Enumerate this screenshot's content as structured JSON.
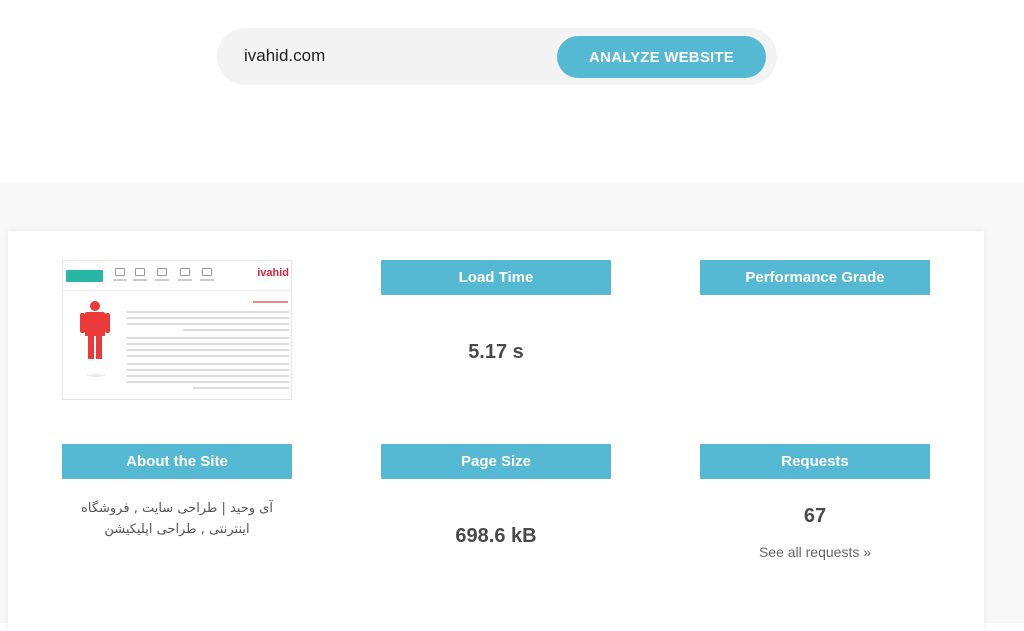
{
  "search": {
    "value": "ivahid.com",
    "button_label": "ANALYZE WEBSITE"
  },
  "results": {
    "load_time": {
      "label": "Load Time",
      "value": "5.17 s"
    },
    "performance_grade": {
      "label": "Performance Grade"
    },
    "about": {
      "label": "About the Site",
      "description": "آی وحید | طراحی سایت , فروشگاه اینترنتی , طراحی اپلیکیشن"
    },
    "page_size": {
      "label": "Page Size",
      "value": "698.6 kB"
    },
    "requests": {
      "label": "Requests",
      "value": "67",
      "link": "See all requests »"
    }
  },
  "thumbnail": {
    "logo": "ivahid"
  },
  "colors": {
    "accent": "#55b9d3",
    "search_bg": "#f3f3f3",
    "section_bg": "#f8f8f8",
    "thumb_brand": "#d9263b",
    "thumb_button": "#28b7a5"
  }
}
